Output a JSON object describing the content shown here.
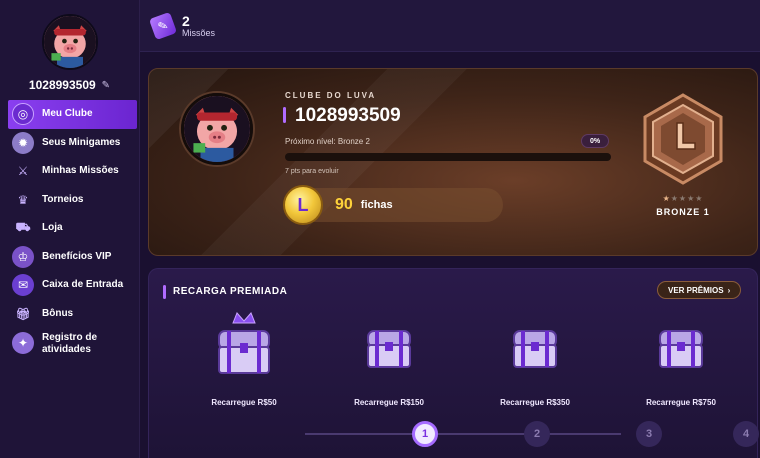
{
  "sidebar": {
    "username": "1028993509",
    "edit_icon": "pencil-icon",
    "items": [
      {
        "label": "Meu Clube",
        "icon": "club-icon",
        "active": true
      },
      {
        "label": "Seus Minigames",
        "icon": "minigames-icon"
      },
      {
        "label": "Minhas Missões",
        "icon": "swords-icon"
      },
      {
        "label": "Torneios",
        "icon": "trophy-icon"
      },
      {
        "label": "Loja",
        "icon": "cart-icon"
      },
      {
        "label": "Benefícios VIP",
        "icon": "crown-icon"
      },
      {
        "label": "Caixa de Entrada",
        "icon": "mail-icon"
      },
      {
        "label": "Bônus",
        "icon": "gift-icon"
      },
      {
        "label": "Registro de atividades",
        "icon": "activity-icon"
      }
    ]
  },
  "topbar": {
    "missions_count": "2",
    "missions_label": "Missões"
  },
  "club": {
    "kicker": "CLUBE DO LUVA",
    "title": "1028993509",
    "next_level": "Próximo nível: Bronze 2",
    "progress_percent_label": "0%",
    "progress_fraction": 0,
    "points_to_evolve": "7 pts para evoluir",
    "chips_value": "90",
    "chips_label": "fichas",
    "chip_letter": "L",
    "badge_name": "BRONZE 1",
    "badge_stars_total": 5,
    "badge_stars_lit": 1
  },
  "recharge": {
    "title": "RECARGA PREMIADA",
    "prizes_button": "VER PRÊMIOS",
    "items": [
      {
        "label": "Recarregue R$50",
        "crowned": true
      },
      {
        "label": "Recarregue R$150",
        "crowned": false
      },
      {
        "label": "Recarregue R$350",
        "crowned": false
      },
      {
        "label": "Recarregue R$750",
        "crowned": false
      }
    ],
    "steps": [
      "1",
      "2",
      "3",
      "4"
    ],
    "active_step": 0
  },
  "colors": {
    "accent": "#b06cff",
    "sidebar_bg": "#1f1438",
    "active_nav": "#8a3ff0",
    "coin": "#f2c73a",
    "chips_value": "#ffd23a"
  }
}
